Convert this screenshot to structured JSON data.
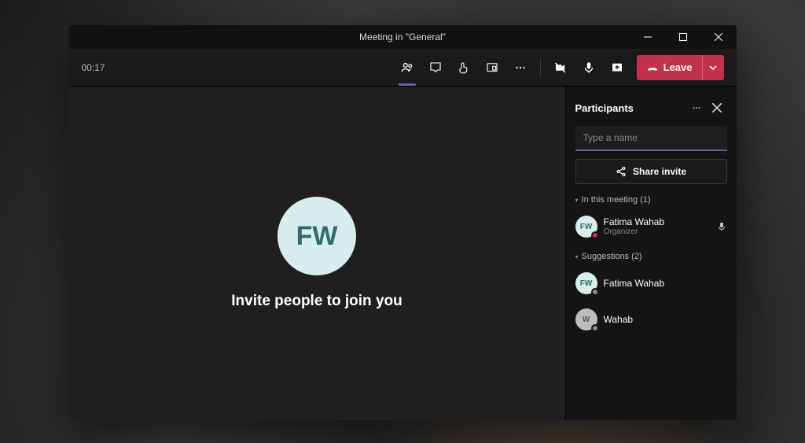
{
  "window": {
    "title": "Meeting in \"General\""
  },
  "toolbar": {
    "timer": "00:17",
    "leave_label": "Leave"
  },
  "stage": {
    "avatar_initials": "FW",
    "invite_text": "Invite people to join you"
  },
  "panel": {
    "title": "Participants",
    "search_placeholder": "Type a name",
    "share_invite_label": "Share invite",
    "in_meeting_label": "In this meeting (1)",
    "suggestions_label": "Suggestions (2)",
    "in_meeting": [
      {
        "name": "Fatima Wahab",
        "role": "Organizer",
        "initials": "FW",
        "avatar": "teal",
        "presence": "busy"
      }
    ],
    "suggestions": [
      {
        "name": "Fatima Wahab",
        "initials": "FW",
        "avatar": "teal",
        "presence": "away"
      },
      {
        "name": "Wahab",
        "initials": "W",
        "avatar": "gray",
        "presence": "away"
      }
    ]
  }
}
